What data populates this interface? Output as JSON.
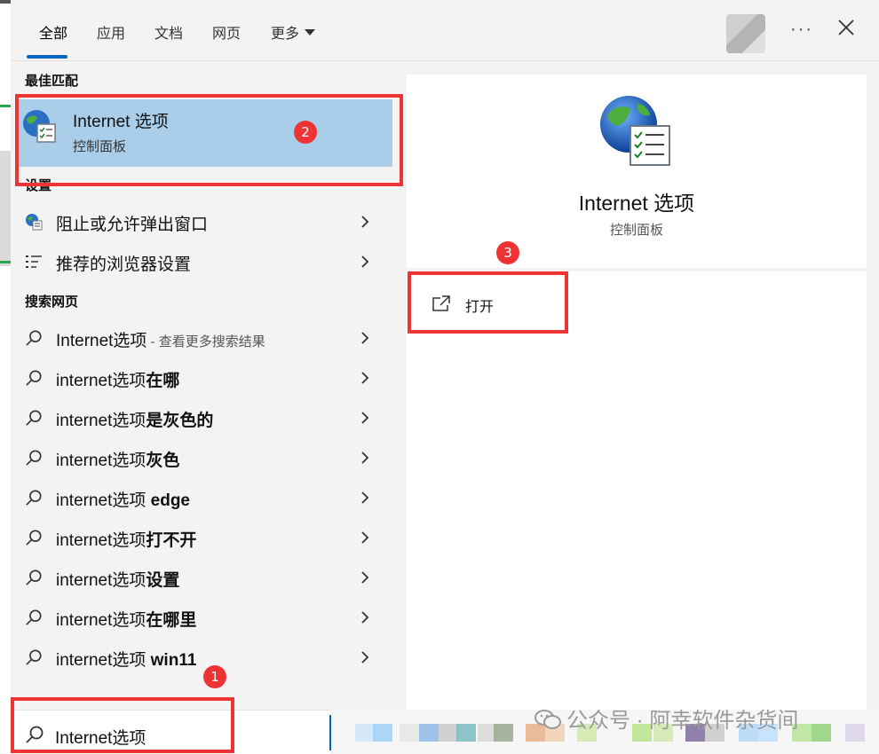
{
  "tabs": [
    {
      "label": "全部",
      "active": true
    },
    {
      "label": "应用"
    },
    {
      "label": "文档"
    },
    {
      "label": "网页"
    },
    {
      "label": "更多"
    }
  ],
  "header": {
    "more_dots": "···"
  },
  "best_match": {
    "section_title": "最佳匹配",
    "title": "Internet 选项",
    "subtitle": "控制面板"
  },
  "settings": {
    "section_title": "设置",
    "items": [
      {
        "label": "阻止或允许弹出窗口",
        "icon": "globe-icon"
      },
      {
        "label": "推荐的浏览器设置",
        "icon": "settings-list-icon"
      }
    ]
  },
  "web_search": {
    "section_title": "搜索网页",
    "items": [
      {
        "prefix": "Internet选项",
        "bold": "",
        "hint": " - 查看更多搜索结果"
      },
      {
        "prefix": "internet选项",
        "bold": "在哪",
        "hint": ""
      },
      {
        "prefix": "internet选项",
        "bold": "是灰色的",
        "hint": ""
      },
      {
        "prefix": "internet选项",
        "bold": "灰色",
        "hint": ""
      },
      {
        "prefix": "internet选项 ",
        "bold": "edge",
        "hint": ""
      },
      {
        "prefix": "internet选项",
        "bold": "打不开",
        "hint": ""
      },
      {
        "prefix": "internet选项",
        "bold": "设置",
        "hint": ""
      },
      {
        "prefix": "internet选项",
        "bold": "在哪里",
        "hint": ""
      },
      {
        "prefix": "internet选项 ",
        "bold": "win11",
        "hint": ""
      }
    ]
  },
  "detail": {
    "title": "Internet 选项",
    "subtitle": "控制面板",
    "action_open": "打开"
  },
  "search": {
    "value": "Internet选项"
  },
  "watermark": "公众号 · 阿幸软件杂货间",
  "annotations": {
    "badge1": "1",
    "badge2": "2",
    "badge3": "3"
  },
  "colors": {
    "accent": "#0067c0",
    "selection": "#aacdea",
    "annotation_red": "#ee3335"
  }
}
